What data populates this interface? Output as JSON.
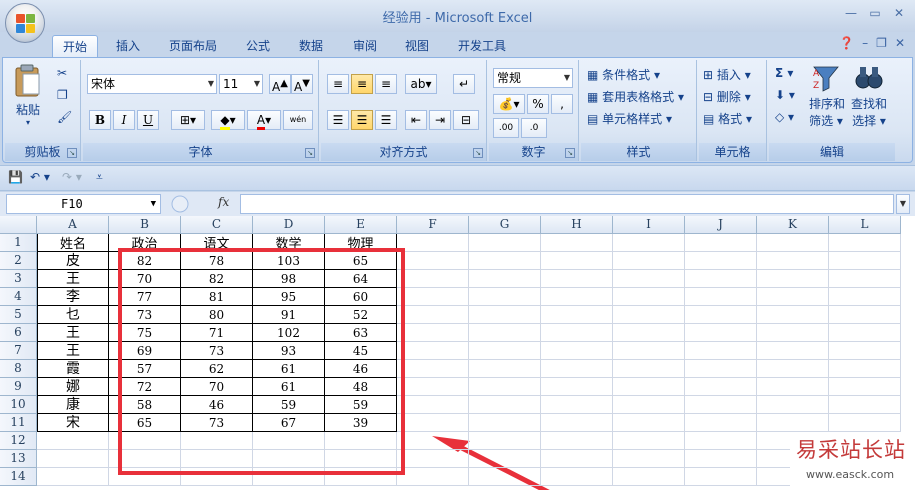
{
  "window": {
    "title": "经验用 - Microsoft Excel"
  },
  "ribbon_tabs": [
    "开始",
    "插入",
    "页面布局",
    "公式",
    "数据",
    "审阅",
    "视图",
    "开发工具"
  ],
  "clipboard": {
    "paste_label": "粘贴",
    "group_label": "剪贴板"
  },
  "font": {
    "name": "宋体",
    "size": "11",
    "bold": "B",
    "italic": "I",
    "underline": "U",
    "phonetic": "wén",
    "group_label": "字体"
  },
  "alignment": {
    "group_label": "对齐方式"
  },
  "number": {
    "format": "常规",
    "percent": "%",
    "comma": ",",
    "inc_dec": ".00",
    "dec_dec": ".0",
    "group_label": "数字"
  },
  "styles": {
    "conditional": "条件格式",
    "table": "套用表格格式",
    "cell": "单元格样式",
    "group_label": "样式"
  },
  "cells": {
    "insert": "插入",
    "delete": "删除",
    "format": "格式",
    "group_label": "单元格"
  },
  "editing": {
    "sum": "Σ",
    "sort_filter_1": "排序和",
    "sort_filter_2": "筛选",
    "find_select_1": "查找和",
    "find_select_2": "选择",
    "group_label": "编辑"
  },
  "formula_bar": {
    "name_box": "F10",
    "fx": "fx",
    "value": ""
  },
  "columns": [
    "A",
    "B",
    "C",
    "D",
    "E",
    "F",
    "G",
    "H",
    "I",
    "J",
    "K",
    "L"
  ],
  "rows": [
    "1",
    "2",
    "3",
    "4",
    "5",
    "6",
    "7",
    "8",
    "9",
    "10",
    "11",
    "12",
    "13",
    "14"
  ],
  "table": {
    "headers": [
      "姓名",
      "政治",
      "语文",
      "数学",
      "物理"
    ],
    "data": [
      [
        "皮",
        "82",
        "78",
        "103",
        "65"
      ],
      [
        "王",
        "70",
        "82",
        "98",
        "64"
      ],
      [
        "李",
        "77",
        "81",
        "95",
        "60"
      ],
      [
        "乜",
        "73",
        "80",
        "91",
        "52"
      ],
      [
        "王",
        "75",
        "71",
        "102",
        "63"
      ],
      [
        "王",
        "69",
        "73",
        "93",
        "45"
      ],
      [
        "霞",
        "57",
        "62",
        "61",
        "46"
      ],
      [
        "娜",
        "72",
        "70",
        "61",
        "48"
      ],
      [
        "康",
        "58",
        "46",
        "59",
        "59"
      ],
      [
        "宋",
        "65",
        "73",
        "67",
        "39"
      ]
    ]
  },
  "watermark": {
    "line1": "易采站长站",
    "line2": "www.easck.com"
  },
  "colors": {
    "accent": "#15428b",
    "annotation_red": "#e8303a",
    "grid": "#d0d7e5"
  }
}
